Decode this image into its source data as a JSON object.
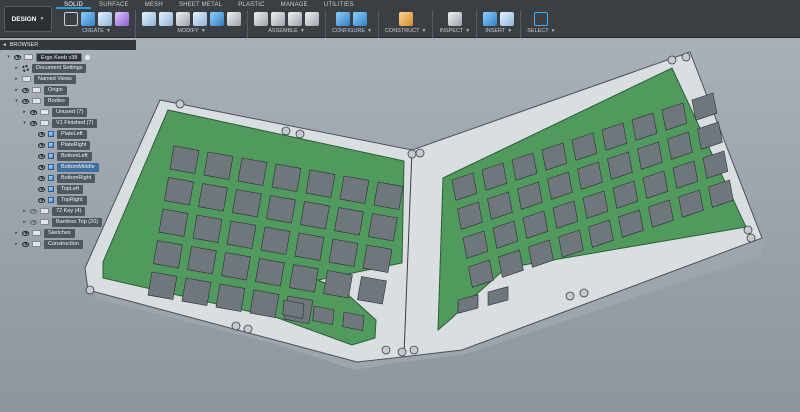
{
  "workspace": {
    "label": "DESIGN"
  },
  "tabs": [
    "SOLID",
    "SURFACE",
    "MESH",
    "SHEET METAL",
    "PLASTIC",
    "MANAGE",
    "UTILITIES"
  ],
  "groups": [
    {
      "label": "CREATE",
      "icons": [
        "sketch-icon",
        "extrude-icon",
        "revolve-icon",
        "box-icon"
      ]
    },
    {
      "label": "MODIFY",
      "icons": [
        "press-pull-icon",
        "fillet-icon",
        "chamfer-icon",
        "shell-icon",
        "combine-icon",
        "move-icon"
      ]
    },
    {
      "label": "ASSEMBLE",
      "icons": [
        "new-component-icon",
        "joint-icon",
        "as-built-joint-icon",
        "motion-link-icon"
      ]
    },
    {
      "label": "CONFIGURE",
      "icons": [
        "configure-table-icon",
        "configure-rule-icon"
      ]
    },
    {
      "label": "CONSTRUCT",
      "icons": [
        "offset-plane-icon"
      ]
    },
    {
      "label": "INSPECT",
      "icons": [
        "measure-icon"
      ]
    },
    {
      "label": "INSERT",
      "icons": [
        "insert-derive-icon",
        "insert-image-icon"
      ]
    },
    {
      "label": "SELECT",
      "icons": [
        "select-window-icon"
      ]
    }
  ],
  "browser": {
    "title": "BROWSER",
    "items": [
      {
        "label": "Ergo Keeb v38",
        "indent": 0,
        "icon": "document"
      },
      {
        "label": "Document Settings",
        "indent": 1,
        "icon": "gear"
      },
      {
        "label": "Named Views",
        "indent": 1,
        "icon": "folder"
      },
      {
        "label": "Origin",
        "indent": 1,
        "icon": "folder"
      },
      {
        "label": "Bodies",
        "indent": 1,
        "icon": "folder"
      },
      {
        "label": "Unused (7)",
        "indent": 2,
        "icon": "folder"
      },
      {
        "label": "V1 Finished (7)",
        "indent": 2,
        "icon": "folder"
      },
      {
        "label": "PlateLeft",
        "indent": 3,
        "icon": "body"
      },
      {
        "label": "PlateRight",
        "indent": 3,
        "icon": "body"
      },
      {
        "label": "BottomLeft",
        "indent": 3,
        "icon": "body"
      },
      {
        "label": "BottomMiddle",
        "indent": 3,
        "icon": "body"
      },
      {
        "label": "BottomRight",
        "indent": 3,
        "icon": "body"
      },
      {
        "label": "TopLeft",
        "indent": 3,
        "icon": "body"
      },
      {
        "label": "TopRight",
        "indent": 3,
        "icon": "body"
      },
      {
        "label": "72 Key (4)",
        "indent": 2,
        "icon": "folder"
      },
      {
        "label": "Bamboo Top (20)",
        "indent": 2,
        "icon": "folder"
      },
      {
        "label": "Sketches",
        "indent": 1,
        "icon": "folder"
      },
      {
        "label": "Construction",
        "indent": 1,
        "icon": "folder"
      }
    ]
  },
  "colors": {
    "plate": "#4f9a5c",
    "case": "#d9dee2",
    "viewport_bg": "#9aa2aa",
    "accent": "#2c9be0"
  }
}
